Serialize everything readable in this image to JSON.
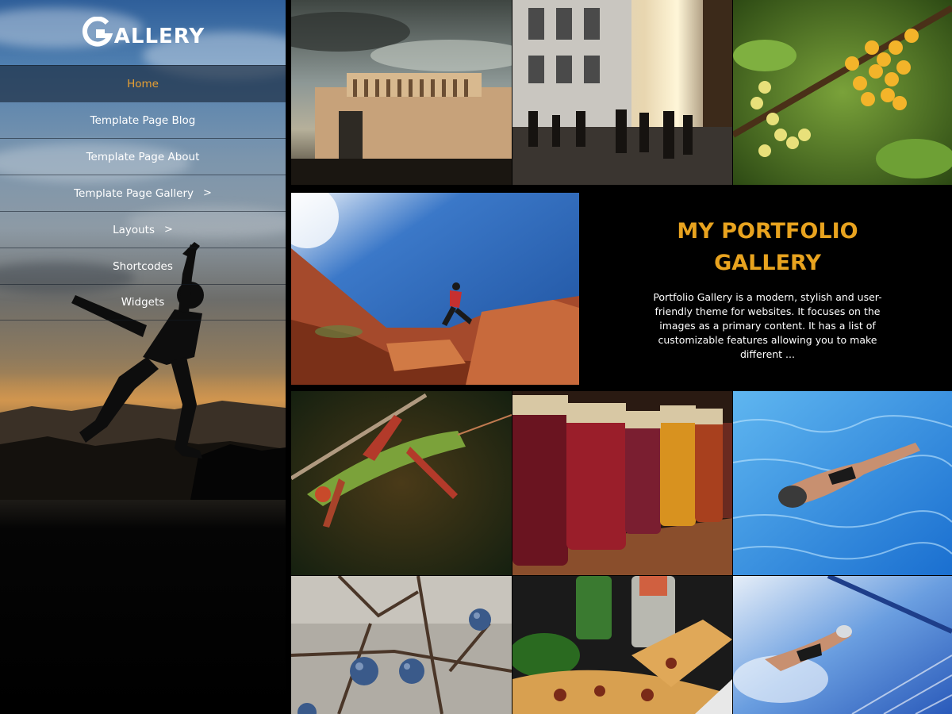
{
  "site": {
    "logo_text": "ALLERY",
    "logo_mark": "G"
  },
  "nav": {
    "items": [
      {
        "label": "Home",
        "active": true,
        "has_submenu": false
      },
      {
        "label": "Template Page Blog",
        "active": false,
        "has_submenu": false
      },
      {
        "label": "Template Page About",
        "active": false,
        "has_submenu": false
      },
      {
        "label": "Template Page Gallery",
        "active": false,
        "has_submenu": true
      },
      {
        "label": "Layouts",
        "active": false,
        "has_submenu": true
      },
      {
        "label": "Shortcodes",
        "active": false,
        "has_submenu": false
      },
      {
        "label": "Widgets",
        "active": false,
        "has_submenu": false
      }
    ],
    "submenu_glyph": ">"
  },
  "intro": {
    "title": "MY PORTFOLIO GALLERY",
    "text": "Portfolio Gallery is a modern, stylish and user-friendly theme for websites. It focuses on the images as a primary content. It has a list of customizable features allowing you to make different ..."
  },
  "gallery": {
    "tiles": [
      {
        "subject": "monument-photo"
      },
      {
        "subject": "street-photo"
      },
      {
        "subject": "berries-photo"
      },
      {
        "subject": "climber-photo"
      },
      {
        "subject": "grasshopper-photo"
      },
      {
        "subject": "jars-photo"
      },
      {
        "subject": "swimmer-photo"
      },
      {
        "subject": "sloe-berries-photo"
      },
      {
        "subject": "pizza-photo"
      },
      {
        "subject": "pool-swimmer-photo"
      }
    ]
  },
  "colors": {
    "accent": "#e8a31f",
    "background": "#000000",
    "nav_text": "#ffffff"
  }
}
